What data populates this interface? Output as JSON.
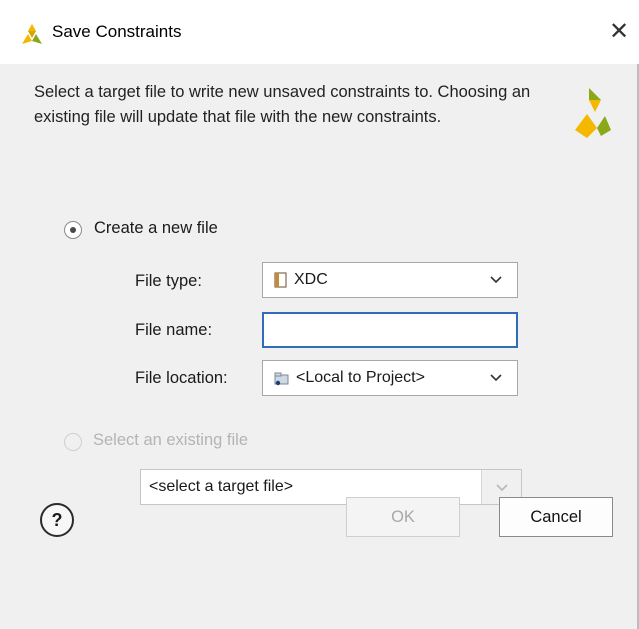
{
  "window": {
    "title": "Save Constraints",
    "close_glyph": "✕"
  },
  "description": "Select a target file to write new unsaved constraints to. Choosing an existing file will update that file with the new constraints.",
  "create_new": {
    "selected": true,
    "label": "Create a new file",
    "file_type_label": "File type:",
    "file_type_value": "XDC",
    "file_type_icon": "xdc-file-icon",
    "file_name_label": "File name:",
    "file_name_value": "",
    "file_location_label": "File location:",
    "file_location_value": "<Local to Project>",
    "file_location_icon": "folder-icon"
  },
  "select_existing": {
    "selected": false,
    "enabled": false,
    "label": "Select an existing file",
    "target_value": "<select a target file>"
  },
  "buttons": {
    "help_glyph": "?",
    "ok": "OK",
    "cancel": "Cancel"
  },
  "colors": {
    "accent_focus": "#2f6eb5",
    "logo_yellow": "#f5b800",
    "logo_green": "#8aa81a"
  }
}
